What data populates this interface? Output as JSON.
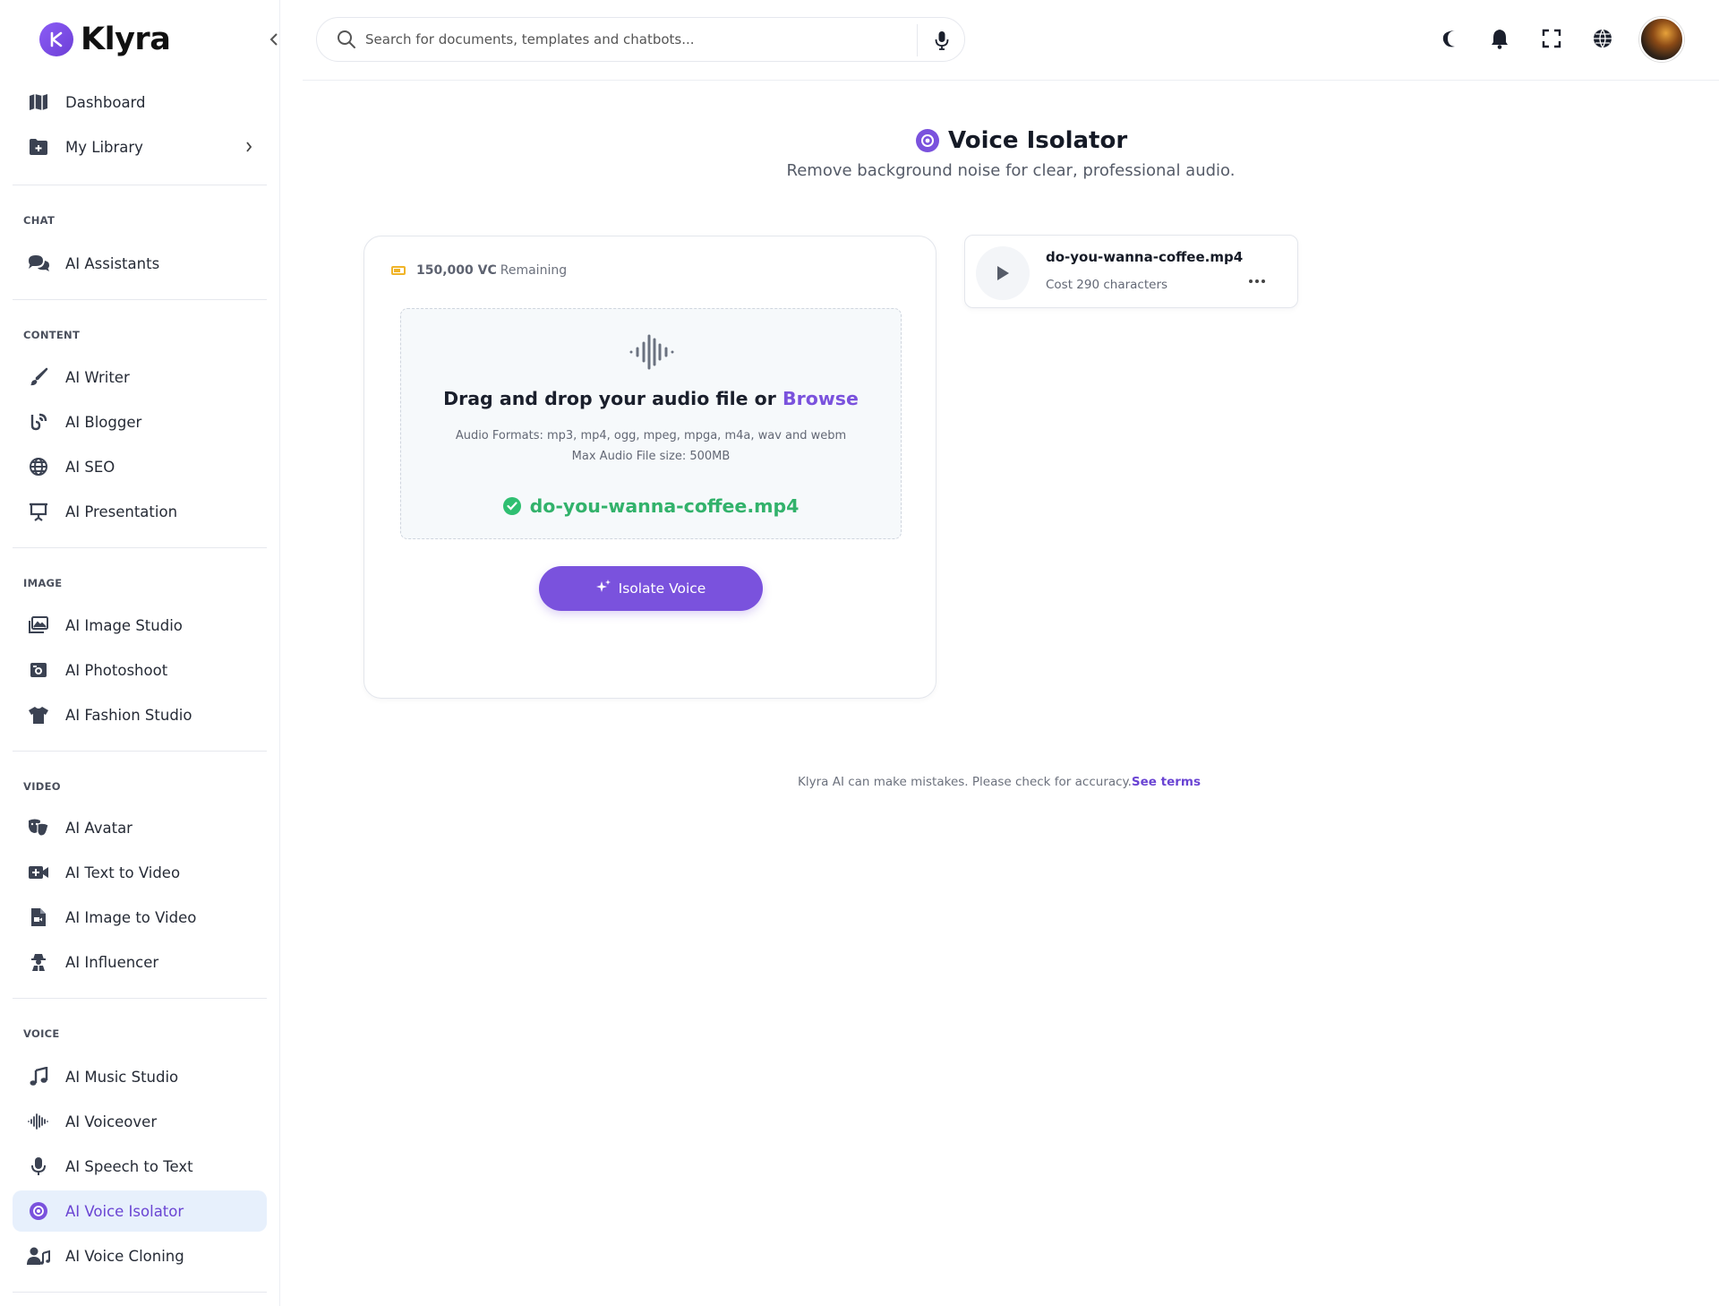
{
  "brand": {
    "name": "Klyra"
  },
  "search": {
    "placeholder": "Search for documents, templates and chatbots..."
  },
  "sidebar": {
    "top_items": [
      {
        "label": "Dashboard",
        "icon": "map-icon"
      },
      {
        "label": "My Library",
        "icon": "folder-plus-icon"
      }
    ],
    "sections": [
      {
        "title": "CHAT",
        "items": [
          {
            "label": "AI Assistants",
            "icon": "chat-bubbles-icon"
          }
        ]
      },
      {
        "title": "CONTENT",
        "items": [
          {
            "label": "AI Writer",
            "icon": "pen-brush-icon"
          },
          {
            "label": "AI Blogger",
            "icon": "blog-icon"
          },
          {
            "label": "AI SEO",
            "icon": "globe-network-icon"
          },
          {
            "label": "AI Presentation",
            "icon": "presentation-icon"
          }
        ]
      },
      {
        "title": "IMAGE",
        "items": [
          {
            "label": "AI Image Studio",
            "icon": "images-icon"
          },
          {
            "label": "AI Photoshoot",
            "icon": "camera-icon"
          },
          {
            "label": "AI Fashion Studio",
            "icon": "shirt-icon"
          }
        ]
      },
      {
        "title": "VIDEO",
        "items": [
          {
            "label": "AI Avatar",
            "icon": "masks-icon"
          },
          {
            "label": "AI Text to Video",
            "icon": "video-plus-icon"
          },
          {
            "label": "AI Image to Video",
            "icon": "file-video-icon"
          },
          {
            "label": "AI Influencer",
            "icon": "influencer-icon"
          }
        ]
      },
      {
        "title": "VOICE",
        "items": [
          {
            "label": "AI Music Studio",
            "icon": "music-icon"
          },
          {
            "label": "AI Voiceover",
            "icon": "waveform-icon"
          },
          {
            "label": "AI Speech to Text",
            "icon": "microphone-icon"
          },
          {
            "label": "AI Voice Isolator",
            "icon": "target-icon",
            "active": true
          },
          {
            "label": "AI Voice Cloning",
            "icon": "user-music-icon"
          }
        ]
      }
    ]
  },
  "header": {
    "icons": [
      "moon-icon",
      "bell-icon",
      "fullscreen-icon",
      "globe-icon",
      "avatar"
    ]
  },
  "page": {
    "title": "Voice Isolator",
    "subtitle": "Remove background noise for clear, professional audio."
  },
  "upload": {
    "credits_value": "150,000 VC",
    "credits_label": "Remaining",
    "drop_text": "Drag and drop your audio file or",
    "browse_label": "Browse",
    "formats": "Audio Formats: mp3, mp4, ogg, mpeg, mpga, m4a, wav and webm",
    "max_size": "Max Audio File size: 500MB",
    "selected_file": "do-you-wanna-coffee.mp4",
    "button_label": "Isolate Voice"
  },
  "result": {
    "filename": "do-you-wanna-coffee.mp4",
    "cost": "Cost 290 characters"
  },
  "footer": {
    "note": "Klyra AI can make mistakes. Please check for accuracy.",
    "terms_label": "See terms"
  },
  "colors": {
    "accent": "#7a52dd",
    "success": "#32b26b",
    "active_bg": "#e7f0fc",
    "battery": "#f0b429"
  }
}
